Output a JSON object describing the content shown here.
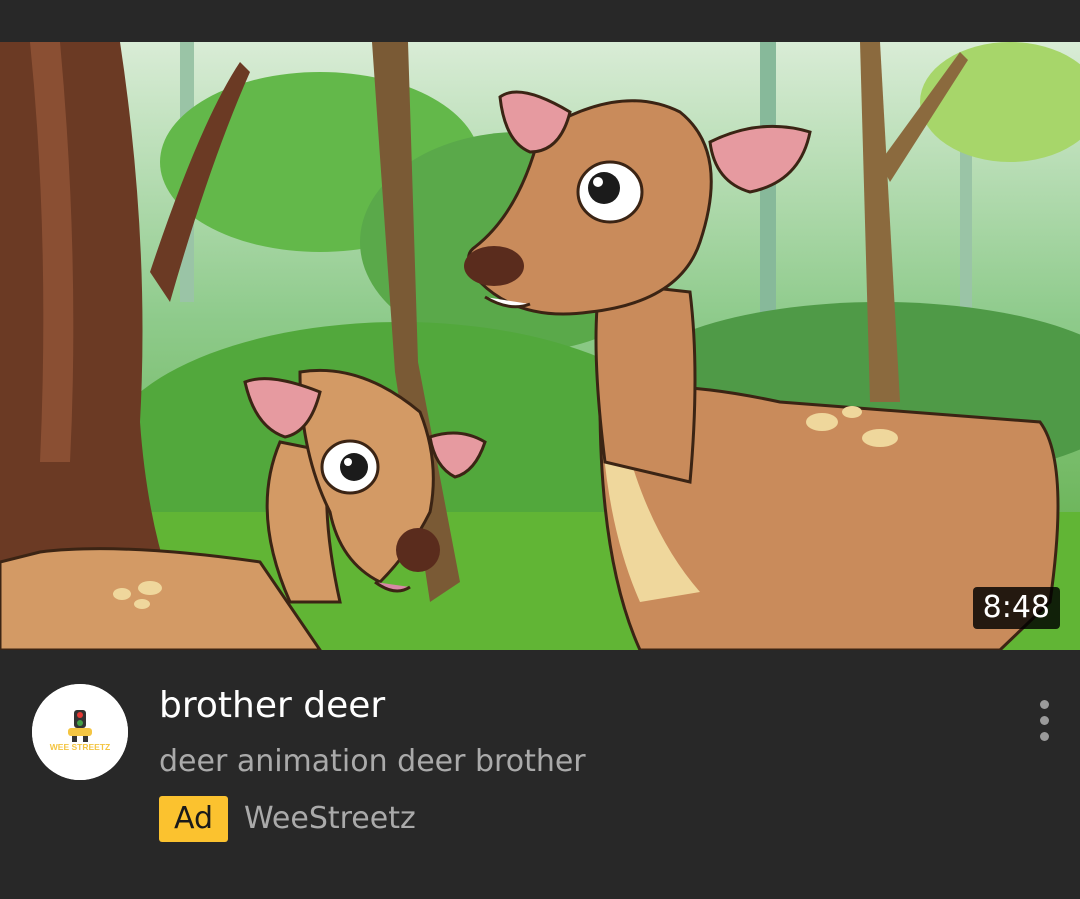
{
  "video": {
    "duration": "8:48",
    "title": "brother deer",
    "description": "deer animation deer brother",
    "ad_label": "Ad",
    "channel": "WeeStreetz",
    "avatar_text": "WEE STREETZ"
  },
  "icons": {
    "menu": "more-vert-icon"
  },
  "colors": {
    "background": "#282828",
    "ad_badge": "#fbc22f",
    "title": "#ffffff",
    "secondary_text": "#aaaaaa"
  }
}
